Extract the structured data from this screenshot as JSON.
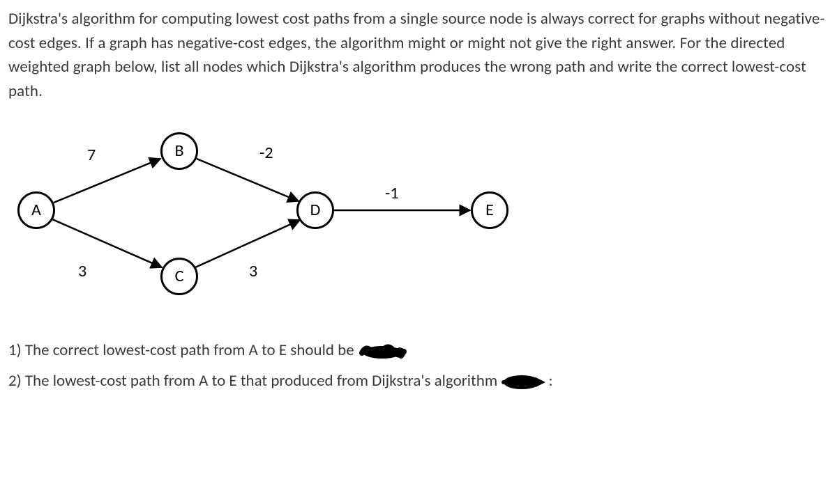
{
  "paragraph": "Dijkstra's algorithm for computing lowest cost paths from a single source node is always correct for graphs without negative-cost edges.  If a graph has negative-cost edges, the algorithm might or might not give the right answer.  For the directed weighted graph below, list all nodes which Dijkstra's algorithm produces the wrong path and write the correct lowest-cost path.",
  "nodes": {
    "A": "A",
    "B": "B",
    "C": "C",
    "D": "D",
    "E": "E"
  },
  "weights": {
    "AB": "7",
    "AC": "3",
    "BD": "-2",
    "CD": "3",
    "DE": "-1"
  },
  "q1": "1) The correct lowest-cost path from A to E should be",
  "q2a": "2) The lowest-cost path from A to E that produced from Dijkstra's algorithm ",
  "q2b": ":",
  "chart_data": {
    "type": "directed_weighted_graph",
    "nodes": [
      "A",
      "B",
      "C",
      "D",
      "E"
    ],
    "edges": [
      {
        "from": "A",
        "to": "B",
        "weight": 7
      },
      {
        "from": "A",
        "to": "C",
        "weight": 3
      },
      {
        "from": "B",
        "to": "D",
        "weight": -2
      },
      {
        "from": "C",
        "to": "D",
        "weight": 3
      },
      {
        "from": "D",
        "to": "E",
        "weight": -1
      }
    ]
  }
}
